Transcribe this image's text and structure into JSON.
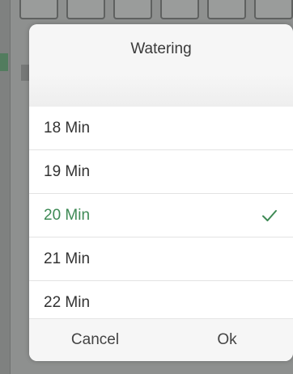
{
  "background": {
    "chips": [
      "",
      "",
      "",
      "",
      "",
      ""
    ]
  },
  "dialog": {
    "title": "Watering",
    "options": [
      {
        "label": "18 Min",
        "selected": false
      },
      {
        "label": "19 Min",
        "selected": false
      },
      {
        "label": "20 Min",
        "selected": true
      },
      {
        "label": "21 Min",
        "selected": false
      },
      {
        "label": "22 Min",
        "selected": false
      }
    ],
    "cancel_label": "Cancel",
    "ok_label": "Ok"
  },
  "colors": {
    "selected": "#3e8a55",
    "text": "#333333"
  },
  "icons": {
    "selected_marker": "check-icon"
  }
}
